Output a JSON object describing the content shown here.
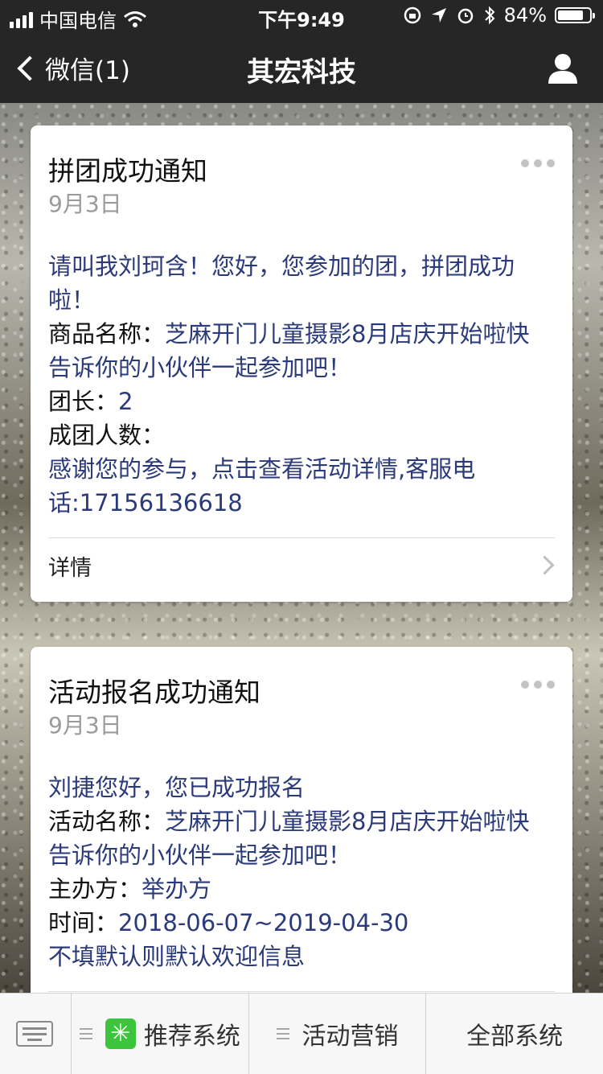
{
  "status_bar": {
    "carrier": "中国电信",
    "time": "下午9:49",
    "battery_text": "84%",
    "battery_level": 0.84
  },
  "nav": {
    "back_label": "微信(1)",
    "title": "其宏科技"
  },
  "cards": [
    {
      "title": "拼团成功通知",
      "date": "9月3日",
      "greeting": "请叫我刘珂含！您好，您参加的团，拼团成功啦！",
      "fields": [
        {
          "label": "商品名称：",
          "value": "芝麻开门儿童摄影8月店庆开始啦快告诉你的小伙伴一起参加吧！"
        },
        {
          "label": "团长：",
          "value": "2"
        },
        {
          "label": "成团人数：",
          "value": ""
        }
      ],
      "remark": "感谢您的参与，点击查看活动详情,客服电话:17156136618",
      "detail_label": "详情"
    },
    {
      "title": "活动报名成功通知",
      "date": "9月3日",
      "greeting": "刘捷您好，您已成功报名",
      "fields": [
        {
          "label": "活动名称：",
          "value": "芝麻开门儿童摄影8月店庆开始啦快告诉你的小伙伴一起参加吧！"
        },
        {
          "label": "主办方：",
          "value": "举办方"
        },
        {
          "label": "时间：",
          "value": "2018-06-07~2019-04-30"
        }
      ],
      "remark": "不填默认则默认欢迎信息"
    }
  ],
  "menu": {
    "items": [
      {
        "label": "推荐系统",
        "badge": "✳"
      },
      {
        "label": "活动营销"
      },
      {
        "label": "全部系统"
      }
    ]
  },
  "colors": {
    "bar_bg": "#262626",
    "link_blue": "#2b3a7a",
    "badge_green": "#3cc43c"
  }
}
